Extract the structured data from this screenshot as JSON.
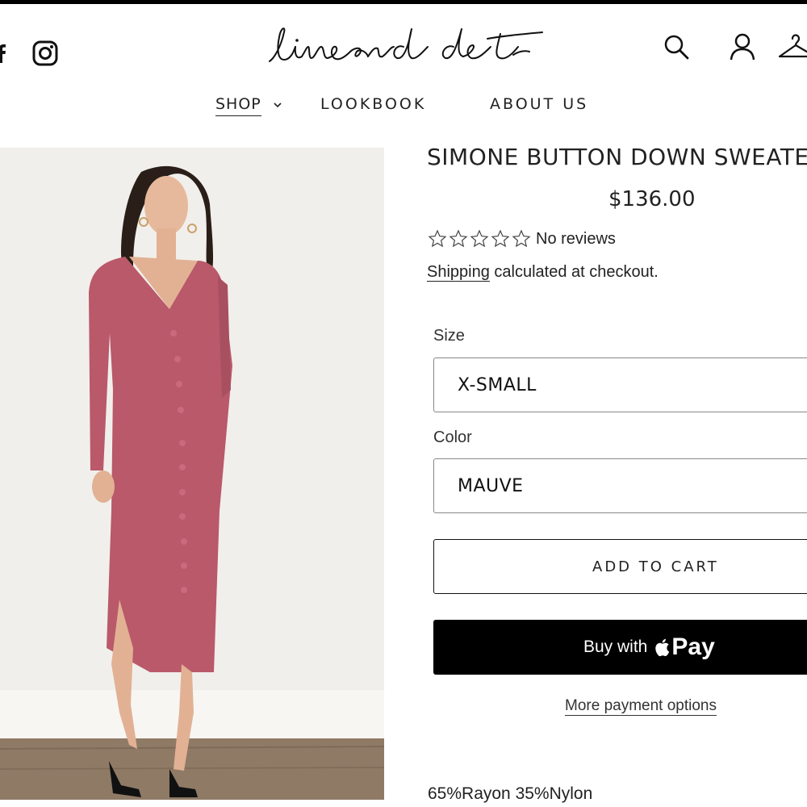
{
  "header": {
    "brand": "line and dot",
    "social": [
      "facebook-icon",
      "instagram-icon"
    ],
    "icons": [
      "search-icon",
      "account-icon",
      "cart-icon"
    ]
  },
  "nav": {
    "items": [
      {
        "label": "SHOP",
        "has_dropdown": true
      },
      {
        "label": "LOOKBOOK"
      },
      {
        "label": "ABOUT US"
      }
    ]
  },
  "product": {
    "title": "SIMONE BUTTON DOWN SWEATE",
    "price": "$136.00",
    "rating": {
      "stars_filled": 0,
      "stars_total": 5,
      "text": "No reviews"
    },
    "shipping": {
      "link": "Shipping",
      "text": "calculated at checkout."
    },
    "size": {
      "label": "Size",
      "value": "X-SMALL"
    },
    "color": {
      "label": "Color",
      "value": "MAUVE"
    },
    "add_to_cart": "ADD TO CART",
    "buy": {
      "prefix": "Buy with",
      "word": "Pay"
    },
    "more_payment": "More payment options",
    "material": "65%Rayon 35%Nylon"
  },
  "colors": {
    "dress": "#b9596a",
    "background": "#f1efeb",
    "floor": "#8f7a66",
    "buy_button": "#000000"
  }
}
